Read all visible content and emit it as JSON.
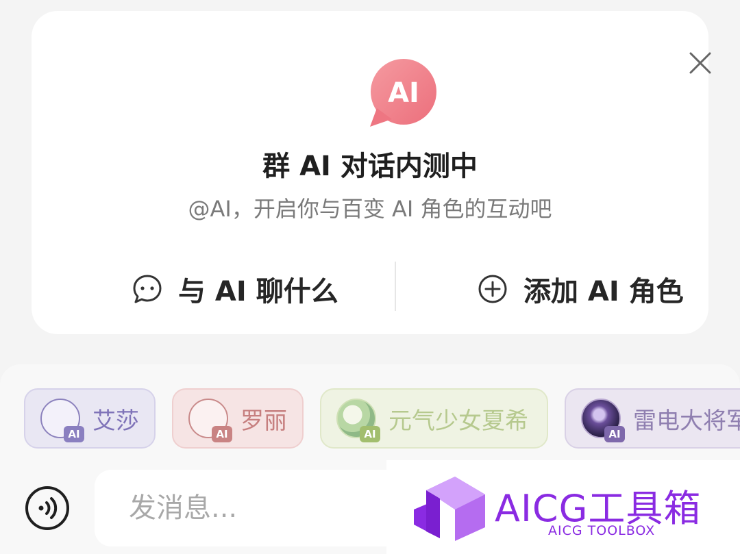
{
  "card": {
    "logo_text": "AI",
    "title": "群 AI 对话内测中",
    "subtitle": "@AI，开启你与百变 AI 角色的互动吧",
    "actions": [
      {
        "label": "与 AI 聊什么",
        "icon": "chat-bubble-icon"
      },
      {
        "label": "添加 AI 角色",
        "icon": "plus-circle-icon"
      }
    ]
  },
  "characters": [
    {
      "name": "艾莎",
      "tag": "AI"
    },
    {
      "name": "罗丽",
      "tag": "AI"
    },
    {
      "name": "元气少女夏希",
      "tag": "AI"
    },
    {
      "name": "雷电大将军",
      "tag": "AI"
    }
  ],
  "composer": {
    "placeholder": "发消息..."
  },
  "watermark": {
    "title": "AICG工具箱",
    "subtitle": "AICG TOOLBOX"
  },
  "colors": {
    "logo": "#f07d86",
    "watermark": "#8a2be2"
  }
}
